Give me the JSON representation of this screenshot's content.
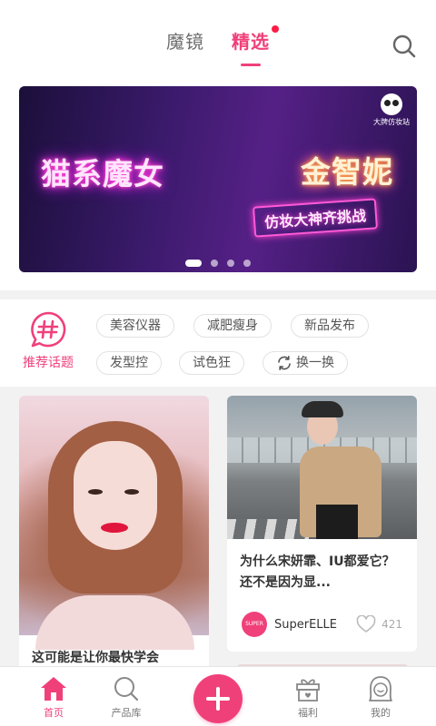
{
  "header": {
    "tabs": [
      {
        "label": "魔镜",
        "active": false
      },
      {
        "label": "精选",
        "active": true,
        "has_badge": true
      }
    ],
    "search_icon": "search-icon"
  },
  "banner": {
    "title_left": "猫系魔女",
    "title_right": "金智妮",
    "subtitle": "仿妆大神齐挑战",
    "brand_label": "大牌仿妆站",
    "slide_count": 4,
    "active_slide": 1
  },
  "topics": {
    "section_label": "推荐话题",
    "icon": "hash-chat-icon",
    "chips": [
      "美容仪器",
      "减肥瘦身",
      "新品发布",
      "发型控",
      "试色狂"
    ],
    "refresh_label": "换一换"
  },
  "feed": {
    "cards": [
      {
        "title": "这可能是让你最快学会"
      },
      {
        "title": "为什么宋妍霏、IU都爱它？还不是因为显...",
        "author": "SuperELLE",
        "avatar_text": "SUPER ELLE",
        "likes": "421"
      }
    ]
  },
  "bottom_nav": {
    "items": [
      {
        "label": "首页",
        "icon": "home-icon",
        "active": true
      },
      {
        "label": "产品库",
        "icon": "search-icon",
        "active": false
      },
      {
        "label": "福利",
        "icon": "gift-icon",
        "active": false
      },
      {
        "label": "我的",
        "icon": "profile-icon",
        "active": false
      }
    ],
    "fab_icon": "plus-icon"
  },
  "colors": {
    "accent": "#f0407a",
    "badge": "#ff1d45"
  }
}
